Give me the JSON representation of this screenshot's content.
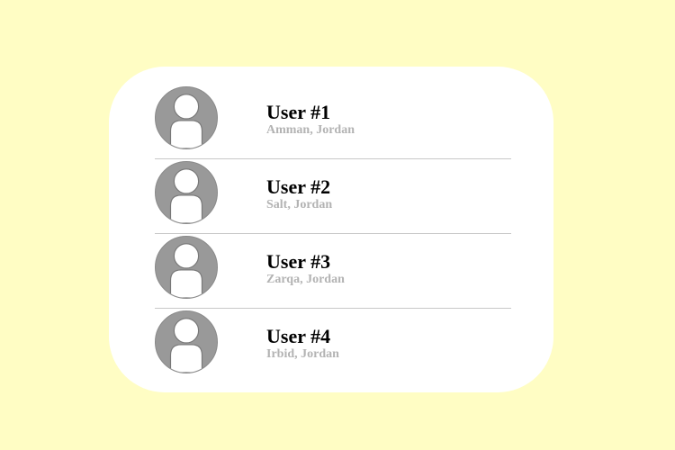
{
  "colors": {
    "page_background": "#fffdc4",
    "card_background": "#ffffff",
    "avatar_fill": "#999999",
    "divider": "#c8c8c8",
    "name_text": "#000000",
    "location_text": "#b3b3b3"
  },
  "users": [
    {
      "name": "User #1",
      "location": "Amman, Jordan",
      "icon": "user-avatar-icon"
    },
    {
      "name": "User #2",
      "location": "Salt, Jordan",
      "icon": "user-avatar-icon"
    },
    {
      "name": "User #3",
      "location": "Zarqa, Jordan",
      "icon": "user-avatar-icon"
    },
    {
      "name": "User #4",
      "location": "Irbid, Jordan",
      "icon": "user-avatar-icon"
    }
  ]
}
